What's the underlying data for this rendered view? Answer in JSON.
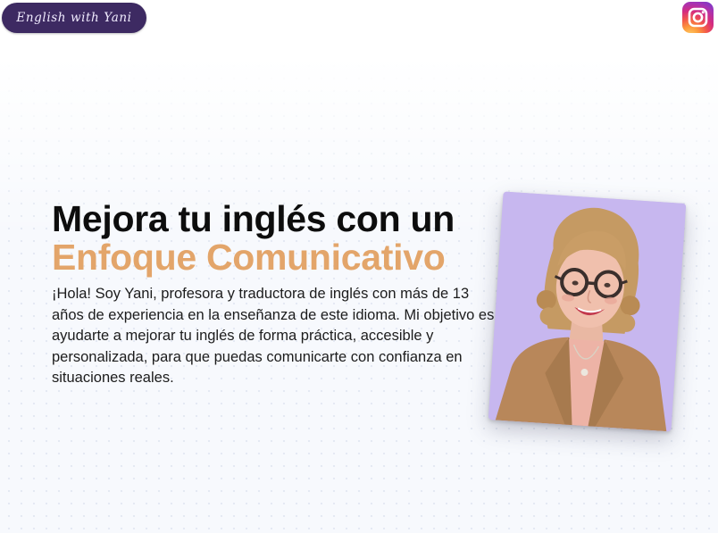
{
  "header": {
    "logo_text": "English with Yani",
    "instagram_icon": "instagram-icon"
  },
  "hero": {
    "title_line1": "Mejora tu inglés con un",
    "title_line2": "Enfoque Comunicativo",
    "intro": "¡Hola! Soy Yani, profesora y traductora de inglés con más de 13 años de experiencia en la enseñanza de este idioma. Mi objetivo es ayudarte a mejorar tu inglés de forma práctica, accesible y personalizada, para que puedas comunicarte con confianza en situaciones reales.",
    "photo": "teacher-portrait"
  },
  "colors": {
    "accent": "#e3a56a",
    "logo_bg": "#3d2a62",
    "photo_bg": "#c8b8f0",
    "heading": "#0d0d0d"
  }
}
